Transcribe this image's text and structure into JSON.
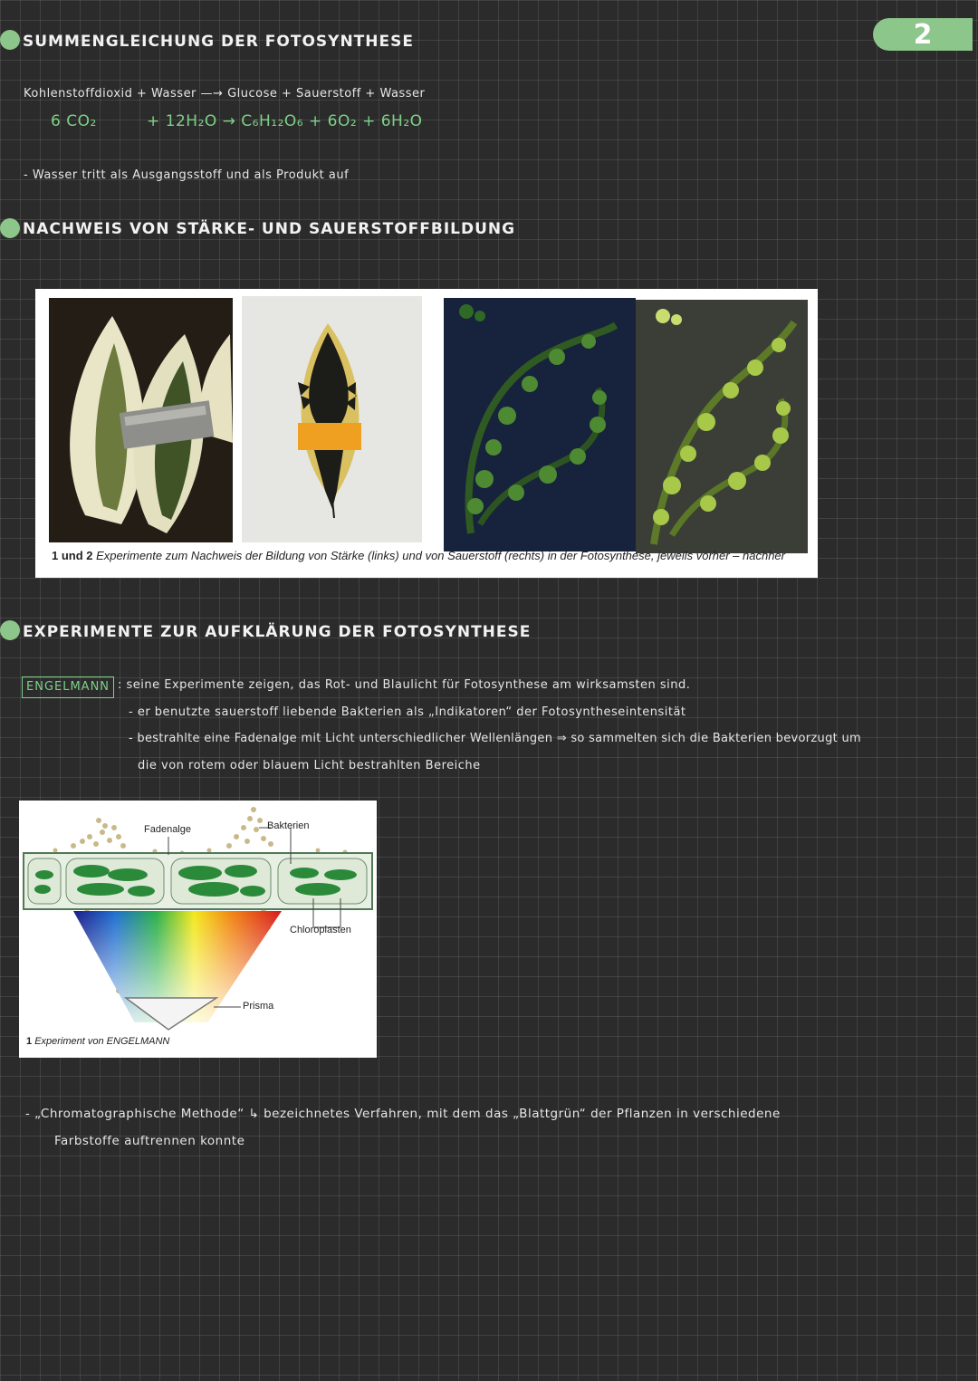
{
  "page_number": "2",
  "colors": {
    "accent": "#8cc68a",
    "background": "#2b2b2b",
    "formula": "#7ed087"
  },
  "section1": {
    "title": "SUMMENGLEICHUNG DER FOTOSYNTHESE",
    "words_line": "Kohlenstoffdioxid  + Wasser —→  Glucose + Sauerstoff + Wasser",
    "formula_left": "6 CO₂",
    "formula_right": "+ 12H₂O → C₆H₁₂O₆ + 6O₂ + 6H₂O",
    "note": "- Wasser tritt als Ausgangsstoff und als Produkt auf"
  },
  "section2": {
    "title": "NACHWEIS VON STÄRKE- UND SAUERSTOFFBILDUNG",
    "caption_num": "1 und 2",
    "caption_text": "Experimente zum Nachweis der Bildung von Stärke (links) und von Sauerstoff (rechts) in der Fotosynthese, jeweils vorher – nachher"
  },
  "section3": {
    "title": "EXPERIMENTE ZUR AUFKLÄRUNG DER FOTOSYNTHESE",
    "tag": "ENGELMANN",
    "line1": ": seine Experimente zeigen, das Rot- und Blaulicht für Fotosynthese am wirksamsten sind.",
    "line2": "- er benutzte sauerstoff liebende Bakterien als „Indikatoren“ der Fotosyntheseintensität",
    "line3": "- bestrahlte eine Fadenalge mit Licht unterschiedlicher Wellenlängen ⇒ so sammelten sich die Bakterien bevorzugt um",
    "line4": "die von rotem oder blauem Licht bestrahlten Bereiche",
    "diagram": {
      "label_fadenalge": "Fadenalge",
      "label_bakterien": "Bakterien",
      "label_chloroplasten": "Chloroplasten",
      "label_prisma": "Prisma",
      "caption_num": "1",
      "caption_text": "Experiment von ENGELMANN"
    },
    "chroma_line1": "- „Chromatographische Methode“ ↳ bezeichnetes Verfahren, mit dem das „Blattgrün“ der Pflanzen in verschiedene",
    "chroma_line2": "Farbstoffe auftrennen konnte"
  }
}
